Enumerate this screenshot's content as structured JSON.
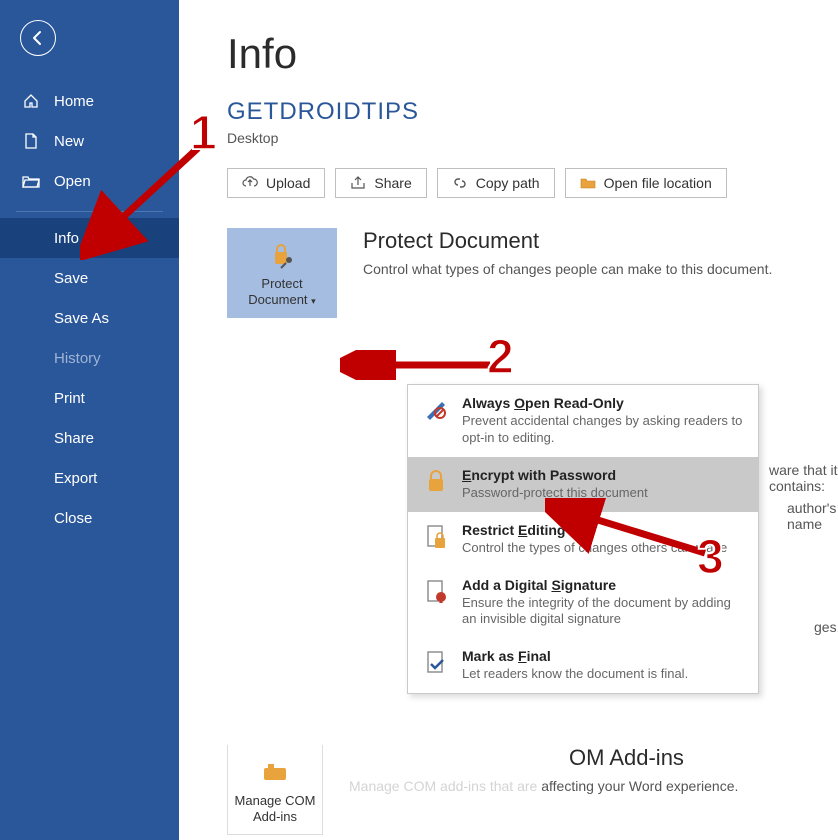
{
  "sidebar": {
    "iconItems": [
      {
        "label": "Home",
        "icon": "home-icon"
      },
      {
        "label": "New",
        "icon": "document-icon"
      },
      {
        "label": "Open",
        "icon": "folder-open-icon"
      }
    ],
    "items": [
      {
        "label": "Info",
        "active": true
      },
      {
        "label": "Save"
      },
      {
        "label": "Save As"
      },
      {
        "label": "History",
        "disabled": true
      },
      {
        "label": "Print"
      },
      {
        "label": "Share"
      },
      {
        "label": "Export"
      },
      {
        "label": "Close"
      }
    ]
  },
  "page": {
    "title": "Info",
    "docTitle": "GETDROIDTIPS",
    "docLocation": "Desktop"
  },
  "toolbar": {
    "upload": "Upload",
    "share": "Share",
    "copyPath": "Copy path",
    "openLocation": "Open file location"
  },
  "protect": {
    "button": "Protect Document",
    "heading": "Protect Document",
    "desc": "Control what types of changes people can make to this document."
  },
  "dropdown": {
    "items": [
      {
        "title": "Always Open Read-Only",
        "uChar": "O",
        "desc": "Prevent accidental changes by asking readers to opt-in to editing."
      },
      {
        "title": "Encrypt with Password",
        "uChar": "E",
        "desc": "Password-protect this document",
        "selected": true
      },
      {
        "title": "Restrict Editing",
        "uChar": "E",
        "uIndex": 9,
        "desc": "Control the types of changes others can make"
      },
      {
        "title": "Add a Digital Signature",
        "uChar": "S",
        "desc": "Ensure the integrity of the document by adding an invisible digital signature"
      },
      {
        "title": "Mark as Final",
        "uChar": "F",
        "desc": "Let readers know the document is final."
      }
    ]
  },
  "inspect": {
    "trailText": "ware that it contains:",
    "bullet": "author's name"
  },
  "checkHidden": {
    "trailText": "ges."
  },
  "comAddins": {
    "button": "Manage COM Add-ins",
    "headingTrail": "OM Add-ins",
    "descObscured": "Manage COM add-ins that are",
    "descTrail": "affecting your Word experience."
  },
  "annotations": {
    "n1": "1",
    "n2": "2",
    "n3": "3"
  }
}
